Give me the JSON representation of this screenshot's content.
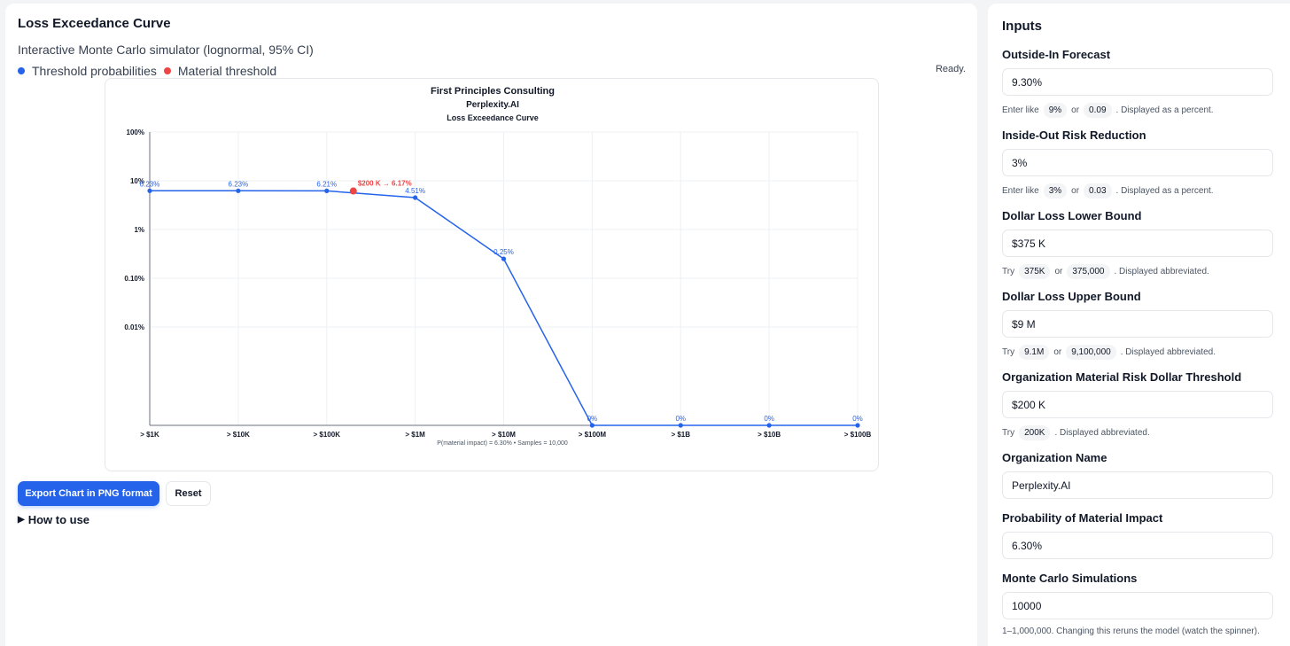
{
  "header": {
    "title": "Loss Exceedance Curve",
    "subtitle": "Interactive Monte Carlo simulator (lognormal, 95% CI)",
    "legend": [
      {
        "label": "Threshold probabilities",
        "color": "#2563eb"
      },
      {
        "label": "Material threshold",
        "color": "#ef4444"
      }
    ],
    "status": "Ready."
  },
  "chart_data": {
    "type": "line",
    "title": "First Principles Consulting",
    "subtitle": "Perplexity.AI",
    "subtitle2": "Loss Exceedance Curve",
    "y_scale": "log",
    "y_ticks": [
      "100%",
      "10%",
      "1%",
      "0.10%",
      "0.01%"
    ],
    "categories": [
      "> $1K",
      "> $10K",
      "> $100K",
      "> $1M",
      "> $10M",
      "> $100M",
      "> $1B",
      "> $10B",
      "> $100B"
    ],
    "series": [
      {
        "name": "Threshold probabilities",
        "values": [
          6.23,
          6.23,
          6.21,
          4.51,
          0.25,
          0,
          0,
          0,
          0
        ],
        "labels": [
          "6.23%",
          "6.23%",
          "6.21%",
          "4.51%",
          "0.25%",
          "0%",
          "0%",
          "0%",
          "0%"
        ],
        "color": "#2563eb"
      }
    ],
    "material_point": {
      "x": 200000,
      "y": 6.17,
      "label": "$200 K → 6.17%",
      "color": "#ef4444"
    },
    "footer": "P(material impact) = 6.30% • Samples = 10,000",
    "grid": true
  },
  "actions": {
    "export_label": "Export Chart in PNG format",
    "reset_label": "Reset",
    "how_to_label": "How to use"
  },
  "inputs": {
    "title": "Inputs",
    "outside_in": {
      "label": "Outside-In Forecast",
      "value": "9.30%",
      "hint_pre": "Enter like",
      "chip1": "9%",
      "hint_or": "or",
      "chip2": "0.09",
      "hint_post": ". Displayed as a percent."
    },
    "inside_out": {
      "label": "Inside-Out Risk Reduction",
      "value": "3%",
      "hint_pre": "Enter like",
      "chip1": "3%",
      "hint_or": "or",
      "chip2": "0.03",
      "hint_post": ". Displayed as a percent."
    },
    "lower_bound": {
      "label": "Dollar Loss Lower Bound",
      "value": "$375 K",
      "hint_pre": "Try",
      "chip1": "375K",
      "hint_or": "or",
      "chip2": "375,000",
      "hint_post": ". Displayed abbreviated."
    },
    "upper_bound": {
      "label": "Dollar Loss Upper Bound",
      "value": "$9 M",
      "hint_pre": "Try",
      "chip1": "9.1M",
      "hint_or": "or",
      "chip2": "9,100,000",
      "hint_post": ". Displayed abbreviated."
    },
    "material_threshold": {
      "label": "Organization Material Risk Dollar Threshold",
      "value": "$200 K",
      "hint_pre": "Try",
      "chip1": "200K",
      "hint_post": ". Displayed abbreviated."
    },
    "org_name": {
      "label": "Organization Name",
      "value": "Perplexity.AI"
    },
    "prob_material": {
      "label": "Probability of Material Impact",
      "value": "6.30%"
    },
    "simulations": {
      "label": "Monte Carlo Simulations",
      "value": "10000",
      "hint": "1–1,000,000. Changing this reruns the model (watch the spinner)."
    }
  }
}
